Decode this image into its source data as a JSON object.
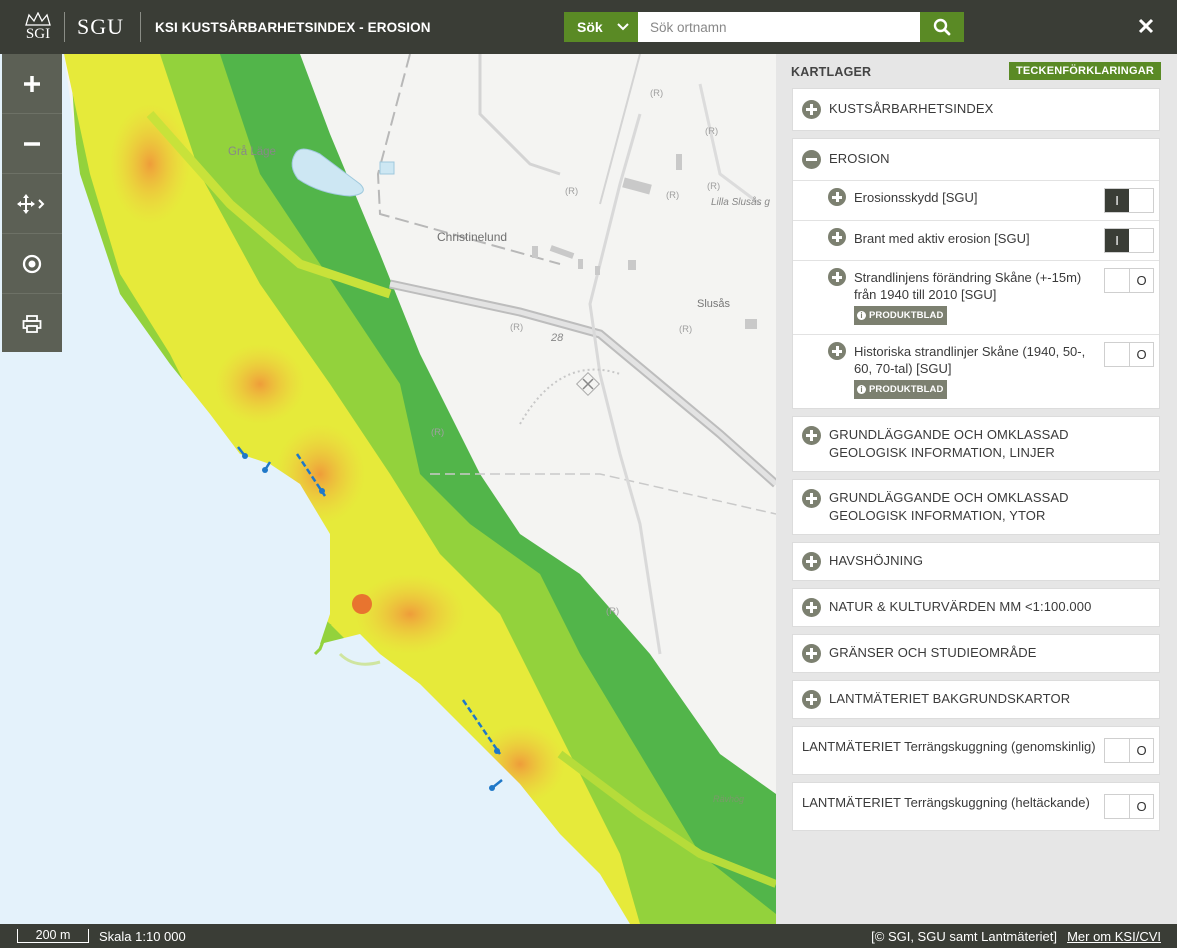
{
  "header": {
    "sgi_logo": "SGI",
    "sgu_logo": "SGU",
    "title": "KSI KUSTSÅRBARHETSINDEX - EROSION",
    "search_type": "Sök",
    "search_placeholder": "Sök ortnamn"
  },
  "map": {
    "labels": {
      "gra_lage": "Grå Läge",
      "christinelund": "Christinelund",
      "lilla_slusas": "Lilla Slusås g",
      "slusas": "Slusås",
      "road_28": "28",
      "ravhog": "Rävhög",
      "r": "(R)"
    }
  },
  "panel": {
    "title": "KARTLAGER",
    "legend_button": "TECKENFÖRKLARINGAR",
    "groups": [
      {
        "label": "KUSTSÅRBARHETSINDEX",
        "expanded": false
      },
      {
        "label": "EROSION",
        "expanded": true,
        "layers": [
          {
            "label": "Erosionsskydd [SGU]",
            "on": true
          },
          {
            "label": "Brant med aktiv erosion [SGU]",
            "on": true
          },
          {
            "label": "Strandlinjens förändring Skåne (+-15m) från 1940 till 2010 [SGU]",
            "on": false,
            "badge": "PRODUKTBLAD"
          },
          {
            "label": "Historiska strandlinjer Skåne (1940, 50-, 60, 70-tal) [SGU]",
            "on": false,
            "badge": "PRODUKTBLAD"
          }
        ]
      },
      {
        "label": "GRUNDLÄGGANDE OCH OMKLASSAD GEOLOGISK INFORMATION, LINJER",
        "expanded": false
      },
      {
        "label": "GRUNDLÄGGANDE OCH OMKLASSAD GEOLOGISK INFORMATION, YTOR",
        "expanded": false
      },
      {
        "label": "HAVSHÖJNING",
        "expanded": false
      },
      {
        "label": "NATUR & KULTURVÄRDEN MM <1:100.000",
        "expanded": false
      },
      {
        "label": "GRÄNSER OCH STUDIEOMRÅDE",
        "expanded": false
      },
      {
        "label": "LANTMÄTERIET BAKGRUNDSKARTOR",
        "expanded": false
      }
    ],
    "standalone": [
      {
        "label": "LANTMÄTERIET Terrängskuggning (genomskinlig)",
        "on": false
      },
      {
        "label": "LANTMÄTERIET Terrängskuggning (heltäckande)",
        "on": false
      }
    ],
    "toggle_on": "I",
    "toggle_off": "O"
  },
  "footer": {
    "scale_bar": "200 m",
    "scale": "Skala 1:10 000",
    "attribution": "[© SGI, SGU samt Lantmäteriet]",
    "more_link": "Mer om KSI/CVI"
  },
  "colors": {
    "header_bg": "#3a3d36",
    "accent_green": "#5a8a25",
    "toolbar": "#5c6055",
    "sea": "#e4f2fb"
  }
}
